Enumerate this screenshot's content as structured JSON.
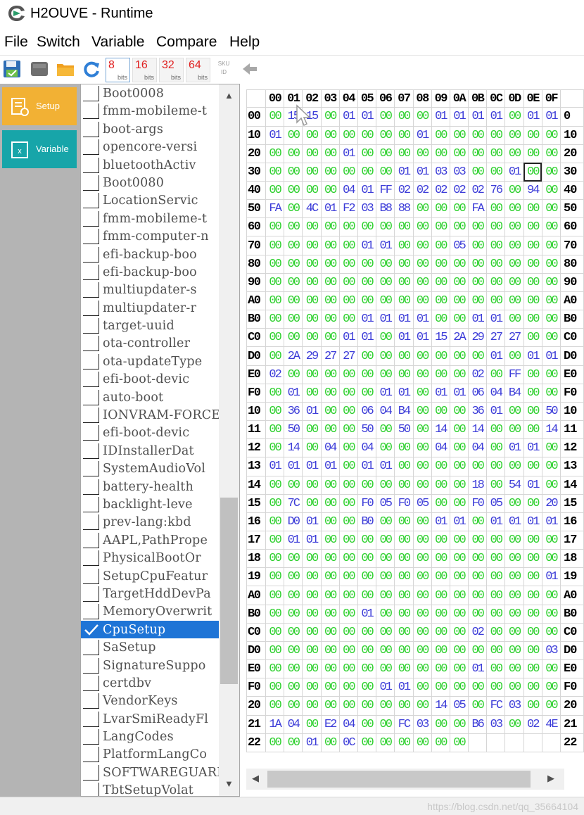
{
  "window": {
    "title": "H2OUVE - Runtime"
  },
  "menu": [
    "File",
    "Switch",
    "Variable",
    "Compare",
    "Help"
  ],
  "toolbar": {
    "bits": [
      {
        "num": "8",
        "label": "bits",
        "active": true
      },
      {
        "num": "16",
        "label": "bits",
        "active": false
      },
      {
        "num": "32",
        "label": "bits",
        "active": false
      },
      {
        "num": "64",
        "label": "bits",
        "active": false
      }
    ],
    "sku": "SKU\nID"
  },
  "sidebar": {
    "setup_label": "Setup",
    "variable_label": "Variable",
    "setup_color": "#f2b134",
    "variable_color": "#17a5a9"
  },
  "variables": [
    "Boot0008",
    "fmm-mobileme-t",
    "boot-args",
    "opencore-versi",
    "bluetoothActiv",
    "Boot0080",
    "LocationServic",
    "fmm-mobileme-t",
    "fmm-computer-n",
    "efi-backup-boo",
    "efi-backup-boo",
    "multiupdater-s",
    "multiupdater-r",
    "target-uuid",
    "ota-controller",
    "ota-updateType",
    "efi-boot-devic",
    "auto-boot",
    "IONVRAM-FORCES",
    "efi-boot-devic",
    "IDInstallerDat",
    "SystemAudioVol",
    "battery-health",
    "backlight-leve",
    "prev-lang:kbd",
    "AAPL,PathPrope",
    "PhysicalBootOr",
    "SetupCpuFeatur",
    "TargetHddDevPa",
    "MemoryOverwrit",
    "CpuSetup",
    "SaSetup",
    "SignatureSuppo",
    "certdbv",
    "VendorKeys",
    "LvarSmiReadyFl",
    "LangCodes",
    "PlatformLangCo",
    "SOFTWAREGUARDS",
    "TbtSetupVolat"
  ],
  "selected_variable": "CpuSetup",
  "hex": {
    "columns": [
      "00",
      "01",
      "02",
      "03",
      "04",
      "05",
      "06",
      "07",
      "08",
      "09",
      "0A",
      "0B",
      "0C",
      "0D",
      "0E",
      "0F"
    ],
    "rows": [
      {
        "left": "00",
        "right": "0",
        "bytes": [
          "00",
          "15",
          "15",
          "00",
          "01",
          "01",
          "00",
          "00",
          "00",
          "01",
          "01",
          "01",
          "01",
          "00",
          "01",
          "01"
        ]
      },
      {
        "left": "10",
        "right": "10",
        "bytes": [
          "01",
          "00",
          "00",
          "00",
          "00",
          "00",
          "00",
          "00",
          "01",
          "00",
          "00",
          "00",
          "00",
          "00",
          "00",
          "00"
        ]
      },
      {
        "left": "20",
        "right": "20",
        "bytes": [
          "00",
          "00",
          "00",
          "00",
          "01",
          "00",
          "00",
          "00",
          "00",
          "00",
          "00",
          "00",
          "00",
          "00",
          "00",
          "00"
        ]
      },
      {
        "left": "30",
        "right": "30",
        "bytes": [
          "00",
          "00",
          "00",
          "00",
          "00",
          "00",
          "00",
          "01",
          "01",
          "03",
          "03",
          "00",
          "00",
          "01",
          "00",
          "00"
        ]
      },
      {
        "left": "40",
        "right": "40",
        "bytes": [
          "00",
          "00",
          "00",
          "00",
          "04",
          "01",
          "FF",
          "02",
          "02",
          "02",
          "02",
          "02",
          "76",
          "00",
          "94",
          "00"
        ]
      },
      {
        "left": "50",
        "right": "50",
        "bytes": [
          "FA",
          "00",
          "4C",
          "01",
          "F2",
          "03",
          "B8",
          "88",
          "00",
          "00",
          "00",
          "FA",
          "00",
          "00",
          "00",
          "00"
        ]
      },
      {
        "left": "60",
        "right": "60",
        "bytes": [
          "00",
          "00",
          "00",
          "00",
          "00",
          "00",
          "00",
          "00",
          "00",
          "00",
          "00",
          "00",
          "00",
          "00",
          "00",
          "00"
        ]
      },
      {
        "left": "70",
        "right": "70",
        "bytes": [
          "00",
          "00",
          "00",
          "00",
          "00",
          "01",
          "01",
          "00",
          "00",
          "00",
          "05",
          "00",
          "00",
          "00",
          "00",
          "00"
        ]
      },
      {
        "left": "80",
        "right": "80",
        "bytes": [
          "00",
          "00",
          "00",
          "00",
          "00",
          "00",
          "00",
          "00",
          "00",
          "00",
          "00",
          "00",
          "00",
          "00",
          "00",
          "00"
        ]
      },
      {
        "left": "90",
        "right": "90",
        "bytes": [
          "00",
          "00",
          "00",
          "00",
          "00",
          "00",
          "00",
          "00",
          "00",
          "00",
          "00",
          "00",
          "00",
          "00",
          "00",
          "00"
        ]
      },
      {
        "left": "A0",
        "right": "A0",
        "bytes": [
          "00",
          "00",
          "00",
          "00",
          "00",
          "00",
          "00",
          "00",
          "00",
          "00",
          "00",
          "00",
          "00",
          "00",
          "00",
          "00"
        ]
      },
      {
        "left": "B0",
        "right": "B0",
        "bytes": [
          "00",
          "00",
          "00",
          "00",
          "00",
          "01",
          "01",
          "01",
          "01",
          "00",
          "00",
          "01",
          "01",
          "00",
          "00",
          "00"
        ]
      },
      {
        "left": "C0",
        "right": "C0",
        "bytes": [
          "00",
          "00",
          "00",
          "00",
          "01",
          "01",
          "00",
          "01",
          "01",
          "15",
          "2A",
          "29",
          "27",
          "27",
          "00",
          "00"
        ]
      },
      {
        "left": "D0",
        "right": "D0",
        "bytes": [
          "00",
          "2A",
          "29",
          "27",
          "27",
          "00",
          "00",
          "00",
          "00",
          "00",
          "00",
          "00",
          "01",
          "00",
          "01",
          "01"
        ]
      },
      {
        "left": "E0",
        "right": "E0",
        "bytes": [
          "02",
          "00",
          "00",
          "00",
          "00",
          "00",
          "00",
          "00",
          "00",
          "00",
          "00",
          "02",
          "00",
          "FF",
          "00",
          "00"
        ]
      },
      {
        "left": "F0",
        "right": "F0",
        "bytes": [
          "00",
          "01",
          "00",
          "00",
          "00",
          "00",
          "01",
          "01",
          "00",
          "01",
          "01",
          "06",
          "04",
          "B4",
          "00",
          "00"
        ]
      },
      {
        "left": "10",
        "right": "10",
        "bytes": [
          "00",
          "36",
          "01",
          "00",
          "00",
          "06",
          "04",
          "B4",
          "00",
          "00",
          "00",
          "36",
          "01",
          "00",
          "00",
          "50"
        ]
      },
      {
        "left": "11",
        "right": "11",
        "bytes": [
          "00",
          "50",
          "00",
          "00",
          "00",
          "50",
          "00",
          "50",
          "00",
          "14",
          "00",
          "14",
          "00",
          "00",
          "00",
          "14"
        ]
      },
      {
        "left": "12",
        "right": "12",
        "bytes": [
          "00",
          "14",
          "00",
          "04",
          "00",
          "04",
          "00",
          "00",
          "00",
          "04",
          "00",
          "04",
          "00",
          "01",
          "01",
          "00"
        ]
      },
      {
        "left": "13",
        "right": "13",
        "bytes": [
          "01",
          "01",
          "01",
          "01",
          "00",
          "01",
          "01",
          "00",
          "00",
          "00",
          "00",
          "00",
          "00",
          "00",
          "00",
          "00"
        ]
      },
      {
        "left": "14",
        "right": "14",
        "bytes": [
          "00",
          "00",
          "00",
          "00",
          "00",
          "00",
          "00",
          "00",
          "00",
          "00",
          "00",
          "18",
          "00",
          "54",
          "01",
          "00"
        ]
      },
      {
        "left": "15",
        "right": "15",
        "bytes": [
          "00",
          "7C",
          "00",
          "00",
          "00",
          "F0",
          "05",
          "F0",
          "05",
          "00",
          "00",
          "F0",
          "05",
          "00",
          "00",
          "20"
        ]
      },
      {
        "left": "16",
        "right": "16",
        "bytes": [
          "00",
          "D0",
          "01",
          "00",
          "00",
          "B0",
          "00",
          "00",
          "00",
          "01",
          "01",
          "00",
          "01",
          "01",
          "01",
          "01"
        ]
      },
      {
        "left": "17",
        "right": "17",
        "bytes": [
          "00",
          "01",
          "01",
          "00",
          "00",
          "00",
          "00",
          "00",
          "00",
          "00",
          "00",
          "00",
          "00",
          "00",
          "00",
          "00"
        ]
      },
      {
        "left": "18",
        "right": "18",
        "bytes": [
          "00",
          "00",
          "00",
          "00",
          "00",
          "00",
          "00",
          "00",
          "00",
          "00",
          "00",
          "00",
          "00",
          "00",
          "00",
          "00"
        ]
      },
      {
        "left": "19",
        "right": "19",
        "bytes": [
          "00",
          "00",
          "00",
          "00",
          "00",
          "00",
          "00",
          "00",
          "00",
          "00",
          "00",
          "00",
          "00",
          "00",
          "00",
          "01"
        ]
      },
      {
        "left": "A0",
        "right": "A0",
        "bytes": [
          "00",
          "00",
          "00",
          "00",
          "00",
          "00",
          "00",
          "00",
          "00",
          "00",
          "00",
          "00",
          "00",
          "00",
          "00",
          "00"
        ]
      },
      {
        "left": "B0",
        "right": "B0",
        "bytes": [
          "00",
          "00",
          "00",
          "00",
          "00",
          "01",
          "00",
          "00",
          "00",
          "00",
          "00",
          "00",
          "00",
          "00",
          "00",
          "00"
        ]
      },
      {
        "left": "C0",
        "right": "C0",
        "bytes": [
          "00",
          "00",
          "00",
          "00",
          "00",
          "00",
          "00",
          "00",
          "00",
          "00",
          "00",
          "02",
          "00",
          "00",
          "00",
          "00"
        ]
      },
      {
        "left": "D0",
        "right": "D0",
        "bytes": [
          "00",
          "00",
          "00",
          "00",
          "00",
          "00",
          "00",
          "00",
          "00",
          "00",
          "00",
          "00",
          "00",
          "00",
          "00",
          "03"
        ]
      },
      {
        "left": "E0",
        "right": "E0",
        "bytes": [
          "00",
          "00",
          "00",
          "00",
          "00",
          "00",
          "00",
          "00",
          "00",
          "00",
          "00",
          "01",
          "00",
          "00",
          "00",
          "00"
        ]
      },
      {
        "left": "F0",
        "right": "F0",
        "bytes": [
          "00",
          "00",
          "00",
          "00",
          "00",
          "00",
          "01",
          "01",
          "00",
          "00",
          "00",
          "00",
          "00",
          "00",
          "00",
          "00"
        ]
      },
      {
        "left": "20",
        "right": "20",
        "bytes": [
          "00",
          "00",
          "00",
          "00",
          "00",
          "00",
          "00",
          "00",
          "00",
          "14",
          "05",
          "00",
          "FC",
          "03",
          "00",
          "00"
        ]
      },
      {
        "left": "21",
        "right": "21",
        "bytes": [
          "1A",
          "04",
          "00",
          "E2",
          "04",
          "00",
          "00",
          "FC",
          "03",
          "00",
          "00",
          "B6",
          "03",
          "00",
          "02",
          "4E"
        ]
      },
      {
        "left": "22",
        "right": "22",
        "bytes": [
          "00",
          "00",
          "01",
          "00",
          "0C",
          "00",
          "00",
          "00",
          "00",
          "00",
          "00",
          "",
          "",
          "",
          "",
          ""
        ]
      }
    ],
    "selected_cell": {
      "row": 3,
      "col": 14
    }
  },
  "watermark": "https://blog.csdn.net/qq_35664104"
}
